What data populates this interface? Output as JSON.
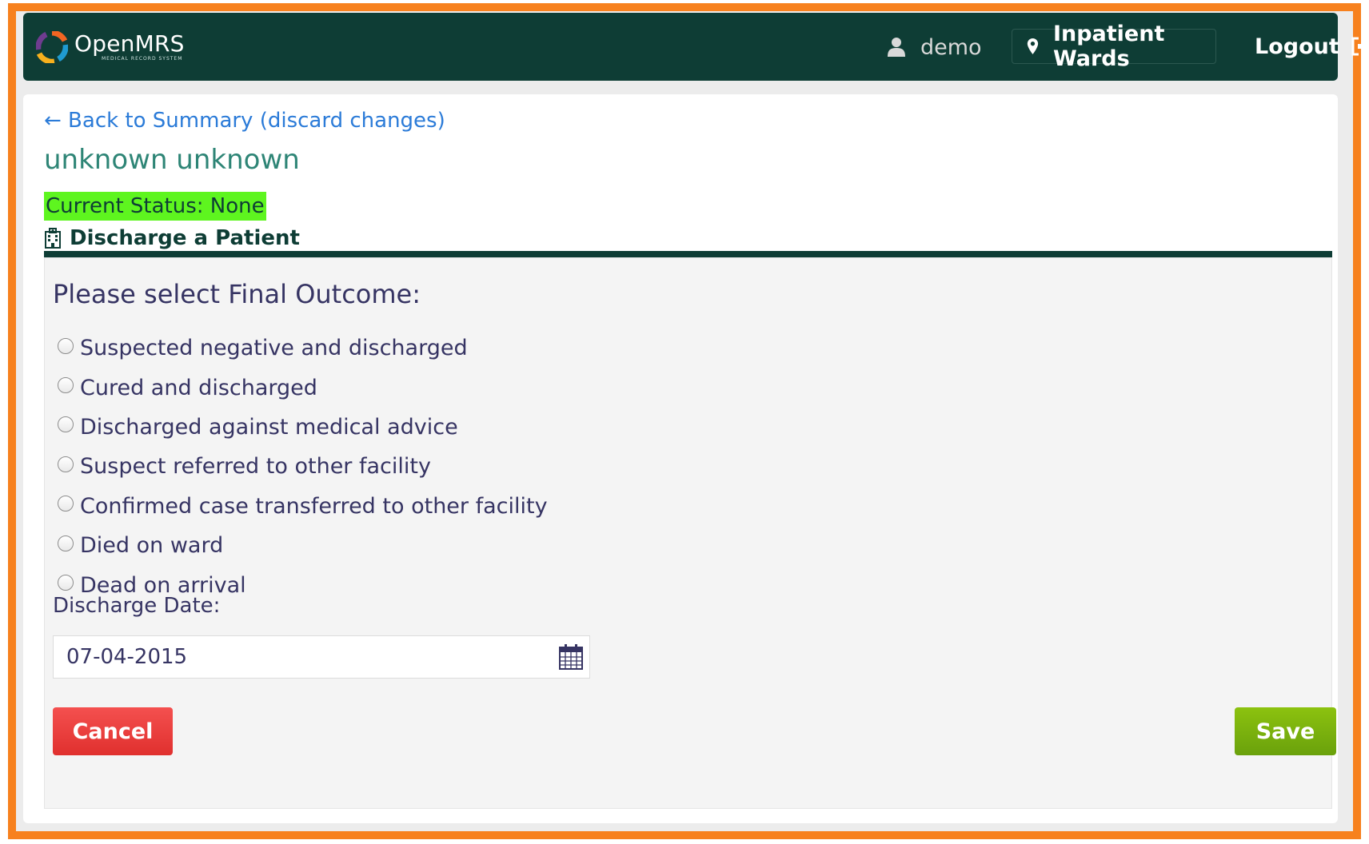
{
  "header": {
    "app_name": "OpenMRS",
    "app_subtitle": "MEDICAL RECORD SYSTEM",
    "user": "demo",
    "location": "Inpatient Wards",
    "logout_label": "Logout",
    "background_color": "#0e3d35"
  },
  "page": {
    "back_link": "← Back to Summary (discard changes)",
    "patient_name": "unknown unknown",
    "status": "Current Status: None",
    "section_title": "Discharge a Patient"
  },
  "form": {
    "question": "Please select Final Outcome:",
    "outcomes": [
      {
        "label": "Suspected negative and discharged",
        "selected": false
      },
      {
        "label": "Cured and discharged",
        "selected": false
      },
      {
        "label": "Discharged against medical advice",
        "selected": false
      },
      {
        "label": "Suspect referred to other facility",
        "selected": false
      },
      {
        "label": "Confirmed case transferred to other facility",
        "selected": false
      },
      {
        "label": "Died on ward",
        "selected": false
      },
      {
        "label": "Dead on arrival",
        "selected": false
      }
    ],
    "date_label": "Discharge Date:",
    "date_value": "07-04-2015",
    "cancel_label": "Cancel",
    "save_label": "Save"
  },
  "colors": {
    "frame": "#f7811e",
    "status_badge": "#5ef51f",
    "link": "#2b7bd8",
    "cancel": "#e0302e",
    "save": "#7cb30e"
  }
}
